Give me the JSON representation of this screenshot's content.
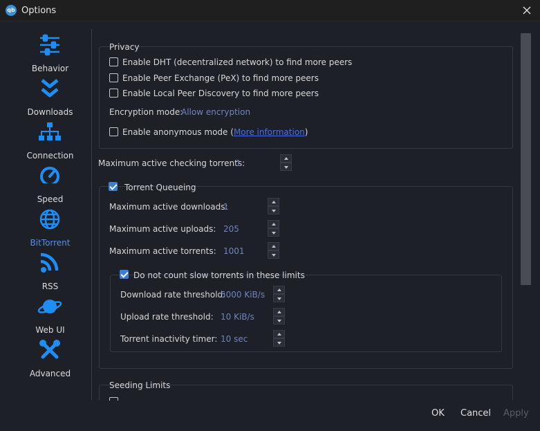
{
  "window": {
    "title": "Options",
    "app_icon_text": "qb"
  },
  "sidebar": {
    "items": [
      {
        "label": "Behavior",
        "icon": "sliders-icon"
      },
      {
        "label": "Downloads",
        "icon": "double-chevron-down-icon"
      },
      {
        "label": "Connection",
        "icon": "network-icon"
      },
      {
        "label": "Speed",
        "icon": "speedometer-icon"
      },
      {
        "label": "BitTorrent",
        "icon": "globe-icon",
        "active": true
      },
      {
        "label": "RSS",
        "icon": "rss-icon"
      },
      {
        "label": "Web UI",
        "icon": "planet-icon"
      },
      {
        "label": "Advanced",
        "icon": "tools-icon"
      }
    ]
  },
  "privacy": {
    "title": "Privacy",
    "dht_label": "Enable DHT (decentralized network) to find more peers",
    "pex_label": "Enable Peer Exchange (PeX) to find more peers",
    "lpd_label": "Enable Local Peer Discovery to find more peers",
    "encryption_label": "Encryption mode:",
    "encryption_value": "Allow encryption",
    "anon_label": "Enable anonymous mode",
    "anon_paren_open": "(",
    "anon_link": "More information",
    "anon_paren_close": ")"
  },
  "checking": {
    "label": "Maximum active checking torrents:",
    "value": "1"
  },
  "queueing": {
    "title": "Torrent Queueing",
    "downloads_label": "Maximum active downloads:",
    "downloads_value": "1",
    "uploads_label": "Maximum active uploads:",
    "uploads_value": "205",
    "torrents_label": "Maximum active torrents:",
    "torrents_value": "1001"
  },
  "slow": {
    "title": "Do not count slow torrents in these limits",
    "download_label": "Download rate threshold:",
    "download_value": "5000 KiB/s",
    "upload_label": "Upload rate threshold:",
    "upload_value": "10 KiB/s",
    "inactivity_label": "Torrent inactivity timer:",
    "inactivity_value": "10 sec"
  },
  "seeding": {
    "title": "Seeding Limits"
  },
  "footer": {
    "ok": "OK",
    "cancel": "Cancel",
    "apply": "Apply"
  },
  "colors": {
    "accent": "#3d7fd6",
    "icon_blue": "#1e8ef5",
    "value_text": "#6f85c2"
  }
}
